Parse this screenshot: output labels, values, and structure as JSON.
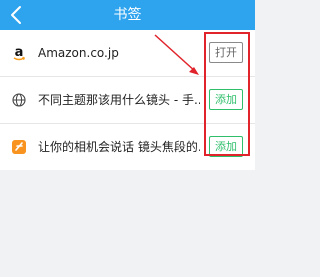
{
  "nav": {
    "title": "书签"
  },
  "rows": [
    {
      "icon": "amazon-icon",
      "label": "Amazon.co.jp",
      "button": "打开",
      "button_type": "open"
    },
    {
      "icon": "globe-icon",
      "label": "不同主题那该用什么镜头 - 手...",
      "button": "添加",
      "button_type": "add"
    },
    {
      "icon": "app-logo-icon",
      "label": "让你的相机会说话 镜头焦段的...",
      "button": "添加",
      "button_type": "add"
    }
  ],
  "colors": {
    "nav": "#2ea4ef",
    "add_button": "#2fbf6b",
    "annotation": "#e1232b"
  }
}
